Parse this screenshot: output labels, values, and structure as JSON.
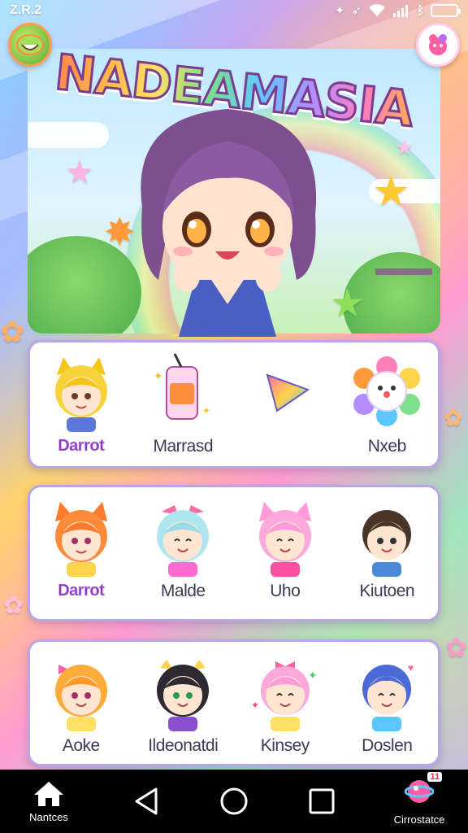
{
  "status_bar": {
    "time": "Z.R.2"
  },
  "app": {
    "title": "NADEAMASIA"
  },
  "colors": {
    "panel_border": "#b9a6e8",
    "highlight_text": "#8a3ab8",
    "nav_background": "#000000"
  },
  "panels": [
    {
      "items": [
        {
          "label": "Darrot",
          "icon": "yellow-cat-girl-icon",
          "highlight": true
        },
        {
          "label": "Marrasd",
          "icon": "juice-can-icon",
          "highlight": false
        },
        {
          "label": "",
          "icon": "play-triangle-icon",
          "highlight": false
        },
        {
          "label": "Nxeb",
          "icon": "flower-face-icon",
          "highlight": false
        }
      ]
    },
    {
      "items": [
        {
          "label": "Darrot",
          "icon": "orange-cat-girl-icon",
          "highlight": true
        },
        {
          "label": "Malde",
          "icon": "blue-haired-girl-icon",
          "highlight": false
        },
        {
          "label": "Uho",
          "icon": "pink-cat-girl-icon",
          "highlight": false
        },
        {
          "label": "Kiutoen",
          "icon": "brown-haired-boy-icon",
          "highlight": false
        }
      ]
    },
    {
      "items": [
        {
          "label": "Aoke",
          "icon": "orange-bow-girl-icon",
          "highlight": false
        },
        {
          "label": "Ildeonatdi",
          "icon": "dark-haired-girl-icon",
          "highlight": false
        },
        {
          "label": "Kinsey",
          "icon": "pink-haired-girl-icon",
          "highlight": false
        },
        {
          "label": "Doslen",
          "icon": "blue-haired-boy-icon",
          "highlight": false
        }
      ]
    }
  ],
  "nav": {
    "home_label": "Nantces",
    "right_label": "Cirrostatce",
    "right_badge": "11"
  }
}
